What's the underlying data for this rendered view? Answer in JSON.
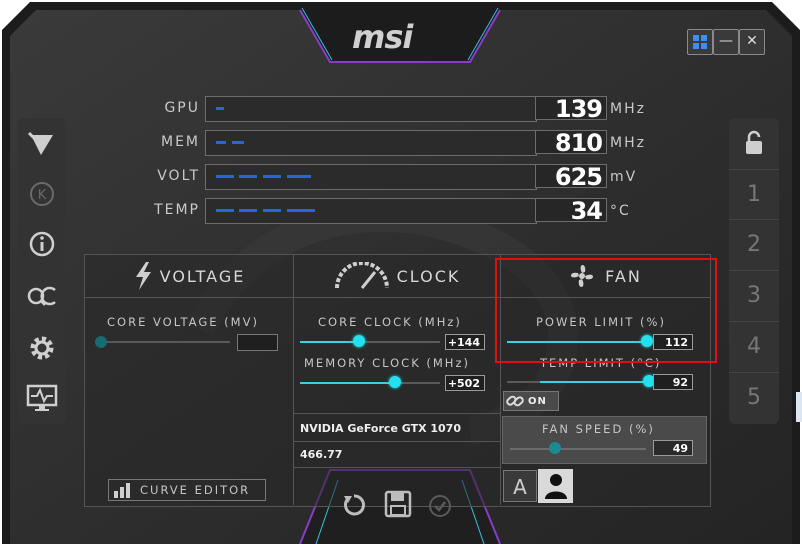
{
  "window": {
    "logo": "msi",
    "buttons": {
      "windows": "",
      "minimize": "—",
      "close": "✕"
    }
  },
  "monitor": [
    {
      "name": "GPU",
      "value": "139",
      "unit": "MHz",
      "dashes": 1
    },
    {
      "name": "MEM",
      "value": "810",
      "unit": "MHz",
      "dashes": 2
    },
    {
      "name": "VOLT",
      "value": "625",
      "unit": "mV",
      "dashes": 5
    },
    {
      "name": "TEMP",
      "value": "34",
      "unit": "°C",
      "dashes": 5
    }
  ],
  "sidebar_left": {
    "items": [
      "msi-dragon-icon",
      "k-boost-icon",
      "info-icon",
      "oc-scanner-icon",
      "settings-icon",
      "monitor-icon"
    ]
  },
  "profiles": {
    "lock": "lock-icon",
    "slots": [
      "1",
      "2",
      "3",
      "4",
      "5"
    ]
  },
  "voltage": {
    "title": "VOLTAGE",
    "core_voltage_label": "CORE VOLTAGE (MV)",
    "core_voltage_value": "",
    "curve_editor_label": "CURVE EDITOR"
  },
  "clock": {
    "title": "CLOCK",
    "core_clock_label": "CORE CLOCK (MHz)",
    "core_clock_value": "+144",
    "memory_clock_label": "MEMORY CLOCK (MHz)",
    "memory_clock_value": "+502",
    "gpu_name": "NVIDIA GeForce GTX 1070",
    "driver_version": "466.77"
  },
  "fan": {
    "title": "FAN",
    "power_limit_label": "POWER LIMIT (%)",
    "power_limit_value": "112",
    "temp_limit_label": "TEMP LIMIT (°C)",
    "temp_limit_value": "92",
    "link_toggle_label": "ON",
    "fan_speed_label": "FAN SPEED (%)",
    "fan_speed_value": "49",
    "auto_label": "A"
  },
  "colors": {
    "accent": "#22e0ee",
    "graph": "#2c63d8",
    "highlight": "#e01010",
    "background": "#2b2b2b"
  }
}
